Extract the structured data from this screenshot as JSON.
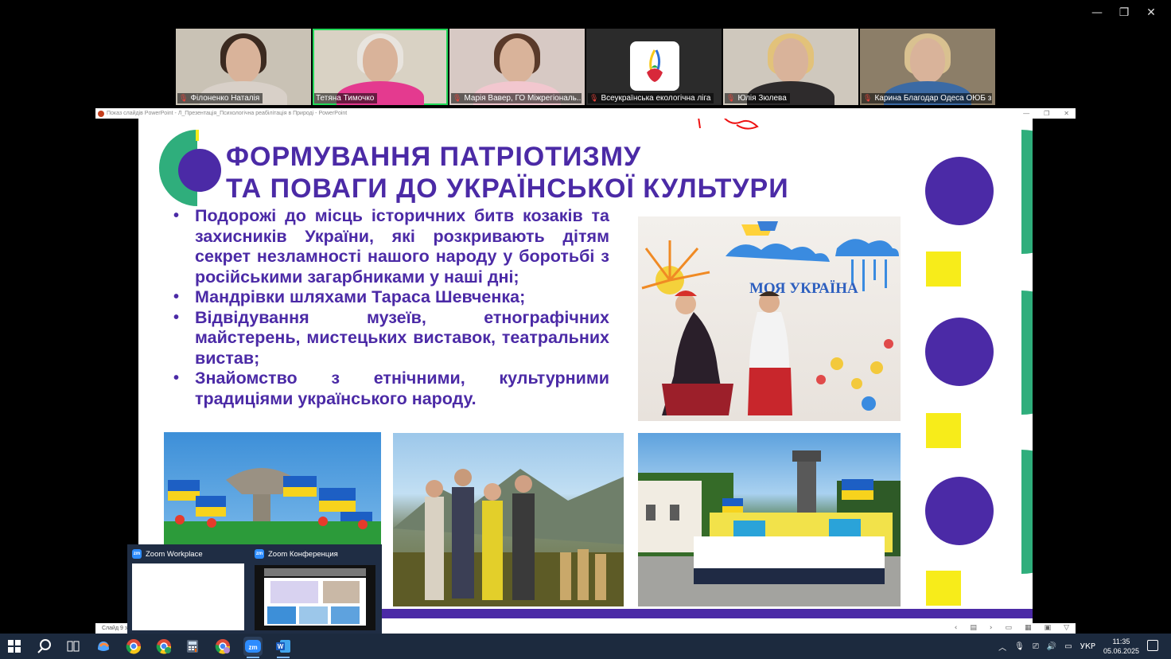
{
  "window": {
    "controls": [
      "—",
      "❐",
      "✕"
    ]
  },
  "participants": [
    {
      "name": "Філоненко Наталія",
      "muted": true,
      "hair": "#3b2a20",
      "body": "#d8d0c8",
      "bg": "#c9c2b5"
    },
    {
      "name": "Тетяна Тимочко",
      "muted": false,
      "hair": "#e8e4de",
      "body": "#e43a8f",
      "bg": "#d9d2c4",
      "active": true
    },
    {
      "name": "Марія Вавер, ГО Міжрегіональ...",
      "muted": true,
      "hair": "#5a3a2a",
      "body": "#f2c7cf",
      "bg": "#d7c9c4"
    },
    {
      "name": "Всеукраїнська екологічна ліга",
      "muted": true,
      "logo": true,
      "bg": "#2b2b2b"
    },
    {
      "name": "Юлія Зюлева",
      "muted": true,
      "hair": "#e2c27a",
      "body": "#2e2b2c",
      "bg": "#cfc8bd"
    },
    {
      "name": "Карина Благодар Одеса ОЮБ з...",
      "muted": true,
      "hair": "#d9c190",
      "body": "#3b6aa4",
      "bg": "#8c7e68"
    }
  ],
  "share_bar": {
    "title": "Показ слайдів PowerPoint - Л_Презентація_Психологічна реабілітація в Природі - PowerPoint"
  },
  "slide": {
    "title_line1": "ФОРМУВАННЯ ПАТРІОТИЗМУ",
    "title_line2": "ТА ПОВАГИ ДО УКРАЇНСЬКОЇ КУЛЬТУРИ",
    "bullets": [
      "Подорожі до місць історичних битв козаків та захисників України, які розкривають дітям секрет незламності нашого народу у боротьбі з російськими загарбниками у наші дні;",
      "Мандрівки шляхами Тараса Шевченка;",
      "Відвідування музеїв, етнографічних майстерень, мистецьких виставок, театральних вистав;",
      "Знайомство з етнічними, культурними традиціями українського народу."
    ],
    "wall_text": "МОЯ УКРАЇНА",
    "colors": {
      "purple": "#4b2aa6",
      "green": "#2fae7c",
      "yellow": "#f7ec1a"
    }
  },
  "ppt_status": {
    "slide_label": "Слайд 9 з",
    "nav": [
      "‹",
      "▤",
      "›",
      "▭",
      "▦",
      "▣",
      "▽"
    ]
  },
  "popup": {
    "app1": "Zoom Workplace",
    "app2": "Zoom Конференция",
    "icon": "zm"
  },
  "taskbar": {
    "icons": [
      "windows-start-icon",
      "search-icon",
      "task-view-icon",
      "copilot-icon",
      "chrome-icon",
      "chrome-profile-icon",
      "calculator-icon",
      "chrome-profile2-icon",
      "zoom-icon",
      "word-icon"
    ],
    "tray": {
      "lang": "УКР",
      "time": "11:35",
      "date": "05.06.2025"
    }
  }
}
